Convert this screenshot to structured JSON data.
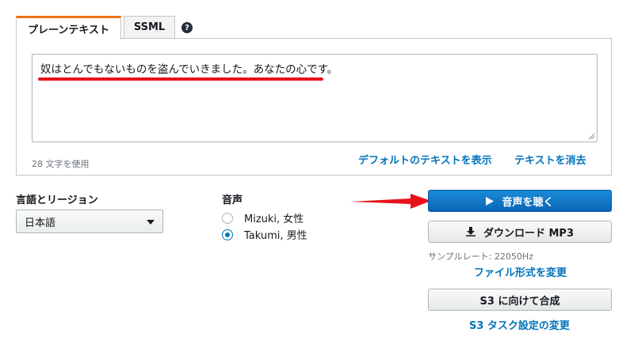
{
  "tabs": {
    "plain_text": "プレーンテキスト",
    "ssml": "SSML",
    "help": "?"
  },
  "editor": {
    "text": "奴はとんでもないものを盗んでいきました。あなたの心です。",
    "char_count": "28 文字を使用",
    "show_default_link": "デフォルトのテキストを表示",
    "clear_link": "テキストを消去"
  },
  "language": {
    "label": "言語とリージョン",
    "selected": "日本語"
  },
  "voice": {
    "label": "音声",
    "options": [
      {
        "label": "Mizuki, 女性",
        "selected": false
      },
      {
        "label": "Takumi, 男性",
        "selected": true
      }
    ]
  },
  "actions": {
    "listen": "音声を聴く",
    "download": "ダウンロード MP3",
    "sample_rate": "サンプルレート: 22050Hz",
    "change_format": "ファイル形式を変更",
    "synthesize_s3": "S3 に向けて合成",
    "s3_task_settings": "S3 タスク設定の変更"
  },
  "colors": {
    "accent_tab": "#ec7211",
    "link": "#0073bb",
    "primary_button": "#0a65b5",
    "annotation_red": "#e8111b"
  },
  "icons": [
    "help-icon",
    "play-icon",
    "download-icon",
    "chevron-down-icon",
    "red-arrow-annotation"
  ]
}
